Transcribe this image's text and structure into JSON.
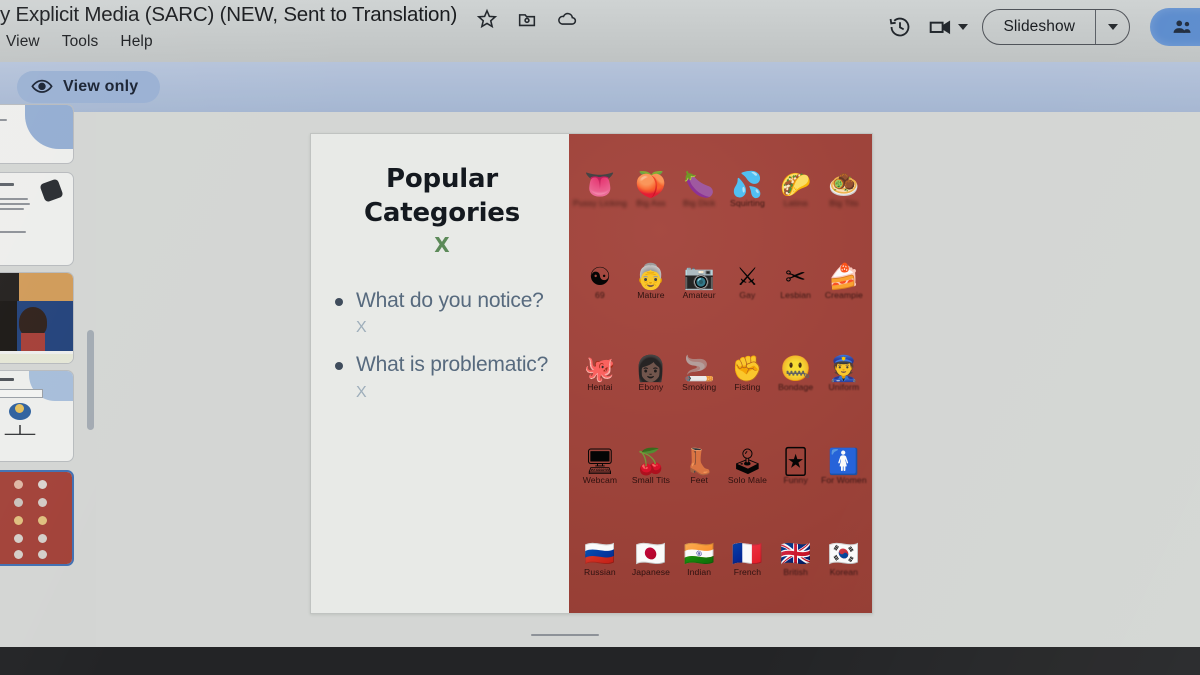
{
  "window": {
    "doc_title": "y Explicit Media (SARC) (NEW, Sent to Translation)",
    "title_icons": [
      "star-icon",
      "move-to-folder-icon",
      "cloud-saved-icon"
    ]
  },
  "menubar": {
    "items": [
      {
        "label": "View"
      },
      {
        "label": "Tools"
      },
      {
        "label": "Help"
      }
    ]
  },
  "toolbar_right": {
    "history_icon": "version-history-icon",
    "camera_label": "",
    "camera_icon": "present-camera-icon",
    "slideshow_label": "Slideshow",
    "slideshow_caret": "chevron-down-icon",
    "share_icon": "share-people-icon"
  },
  "banner": {
    "view_only_label": "View only",
    "eye_icon": "eye-icon"
  },
  "sidebar": {
    "thumbnails": [
      {
        "name": "slide-thumb-1",
        "selected": false
      },
      {
        "name": "slide-thumb-2",
        "selected": false
      },
      {
        "name": "slide-thumb-3",
        "selected": false
      },
      {
        "name": "slide-thumb-4",
        "selected": false
      },
      {
        "name": "slide-thumb-5",
        "selected": true
      }
    ]
  },
  "slide": {
    "title_line_1": "Popular",
    "title_line_2": "Categories",
    "title_marker": "X",
    "bullets": [
      {
        "text": "What do you notice?",
        "marker": "X"
      },
      {
        "text": "What is problematic?",
        "marker": "X"
      }
    ],
    "panel_color": "#a33f35",
    "accent_green": "#5b8a57",
    "bullet_color": "#55697e",
    "categories": [
      {
        "emoji": "👅",
        "label": "Pussy Licking",
        "blur": "heavy"
      },
      {
        "emoji": "🍑",
        "label": "Big Ass",
        "blur": "heavy"
      },
      {
        "emoji": "🍆",
        "label": "Big Dick",
        "blur": "heavy"
      },
      {
        "emoji": "💦",
        "label": "Squirting",
        "blur": "soft"
      },
      {
        "emoji": "🌮",
        "label": "Latina",
        "blur": "heavy"
      },
      {
        "emoji": "🧆",
        "label": "Big Tits",
        "blur": "heavy"
      },
      {
        "emoji": "☯",
        "label": "69",
        "blur": "soft"
      },
      {
        "emoji": "👵",
        "label": "Mature",
        "blur": "none"
      },
      {
        "emoji": "📷",
        "label": "Amateur",
        "blur": "none"
      },
      {
        "emoji": "⚔",
        "label": "Gay",
        "blur": "soft"
      },
      {
        "emoji": "✂",
        "label": "Lesbian",
        "blur": "soft"
      },
      {
        "emoji": "🍰",
        "label": "Creampie",
        "blur": "soft"
      },
      {
        "emoji": "🐙",
        "label": "Hentai",
        "blur": "none"
      },
      {
        "emoji": "👩🏿",
        "label": "Ebony",
        "blur": "none"
      },
      {
        "emoji": "🚬",
        "label": "Smoking",
        "blur": "none"
      },
      {
        "emoji": "✊",
        "label": "Fisting",
        "blur": "none"
      },
      {
        "emoji": "🤐",
        "label": "Bondage",
        "blur": "soft"
      },
      {
        "emoji": "👮",
        "label": "Uniform",
        "blur": "soft"
      },
      {
        "emoji": "🖥",
        "label": "Webcam",
        "blur": "none"
      },
      {
        "emoji": "🍒",
        "label": "Small Tits",
        "blur": "none"
      },
      {
        "emoji": "👢",
        "label": "Feet",
        "blur": "none"
      },
      {
        "emoji": "🕹",
        "label": "Solo Male",
        "blur": "none"
      },
      {
        "emoji": "🃏",
        "label": "Funny",
        "blur": "soft"
      },
      {
        "emoji": "🚺",
        "label": "For Women",
        "blur": "soft"
      },
      {
        "emoji": "🇷🇺",
        "label": "Russian",
        "blur": "none"
      },
      {
        "emoji": "🇯🇵",
        "label": "Japanese",
        "blur": "none"
      },
      {
        "emoji": "🇮🇳",
        "label": "Indian",
        "blur": "none"
      },
      {
        "emoji": "🇫🇷",
        "label": "French",
        "blur": "none"
      },
      {
        "emoji": "🇬🇧",
        "label": "British",
        "blur": "soft"
      },
      {
        "emoji": "🇰🇷",
        "label": "Korean",
        "blur": "soft"
      }
    ]
  }
}
